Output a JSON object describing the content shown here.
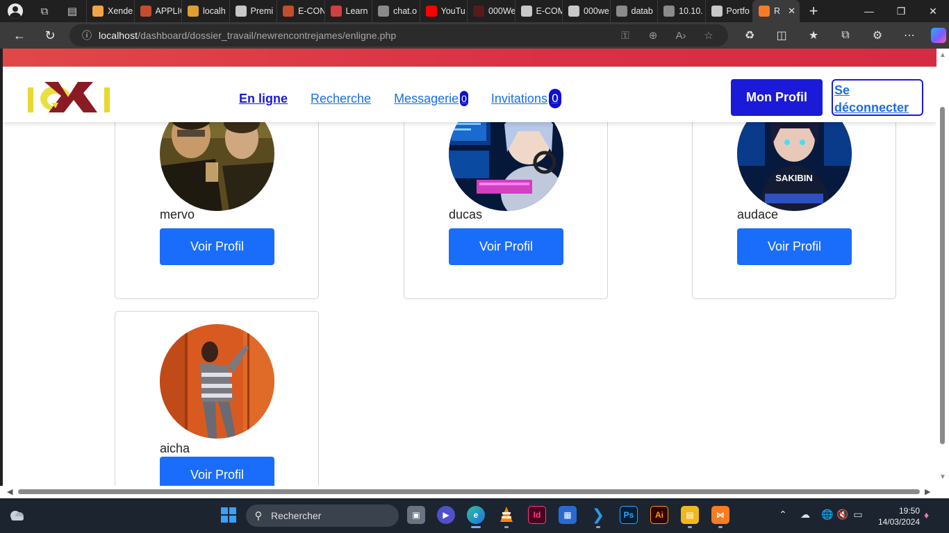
{
  "browser": {
    "tabs": [
      {
        "label": "Xende",
        "fav": "#f2a444"
      },
      {
        "label": "APPLIC",
        "fav": "#c44d2c"
      },
      {
        "label": "localh",
        "fav": "#e0a030"
      },
      {
        "label": "Premi",
        "fav": "#c8c8c8"
      },
      {
        "label": "E-CON",
        "fav": "#c44d2c"
      },
      {
        "label": "Learn",
        "fav": "#d04040"
      },
      {
        "label": "chat.o",
        "fav": "#8a8a8a"
      },
      {
        "label": "YouTu",
        "fav": "#ff0000"
      },
      {
        "label": "000We",
        "fav": "#5a1a1a"
      },
      {
        "label": "E-COM",
        "fav": "#c8c8c8"
      },
      {
        "label": "000we",
        "fav": "#c8c8c8"
      },
      {
        "label": "datab",
        "fav": "#8a8a8a"
      },
      {
        "label": "10.10.",
        "fav": "#8a8a8a"
      },
      {
        "label": "Portfo",
        "fav": "#c8c8c8"
      },
      {
        "label": "R",
        "fav": "#fb7a24",
        "active": true
      }
    ],
    "url_host": "localhost",
    "url_path": "/dashboard/dossier_travail/newrencontrejames/enligne.php"
  },
  "header": {
    "nav": {
      "online": "En ligne",
      "search": "Recherche",
      "messages": "Messagerie",
      "messages_count": "0",
      "invitations": "Invitations",
      "invitations_count": "0"
    },
    "profile_button": "Mon Profil",
    "logout_button": "Se déconnecter"
  },
  "users": [
    {
      "name": "mervo",
      "button": "Voir Profil"
    },
    {
      "name": "ducas",
      "button": "Voir Profil"
    },
    {
      "name": "audace",
      "button": "Voir Profil"
    },
    {
      "name": "aicha",
      "button": "Voir Profil"
    }
  ],
  "avatar_overlay_text": "SAKIBIN",
  "taskbar": {
    "search_placeholder": "Rechercher",
    "time": "19:50",
    "date": "14/03/2024"
  },
  "colors": {
    "accent": "#1a1ad8",
    "button": "#1a6dfa",
    "top_strip": "#d83044"
  }
}
